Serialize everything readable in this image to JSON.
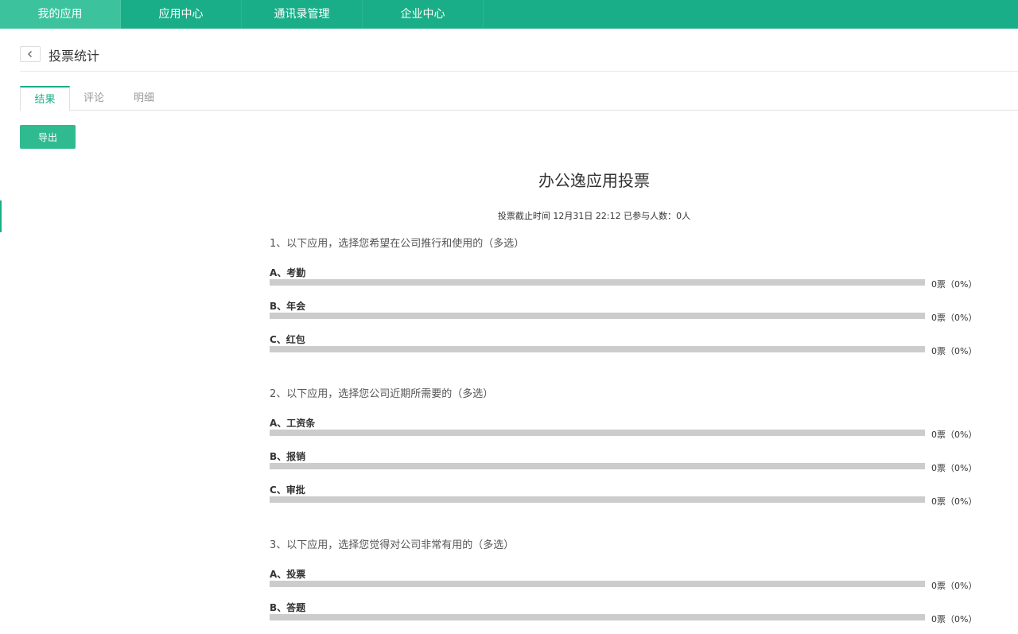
{
  "topnav": {
    "items": [
      {
        "label": "我的应用"
      },
      {
        "label": "应用中心"
      },
      {
        "label": "通讯录管理"
      },
      {
        "label": "企业中心"
      }
    ]
  },
  "header": {
    "title": "投票统计"
  },
  "tabs": [
    {
      "label": "结果"
    },
    {
      "label": "评论"
    },
    {
      "label": "明细"
    }
  ],
  "toolbar": {
    "export_label": "导出"
  },
  "vote": {
    "title": "办公逸应用投票",
    "meta": "投票截止时间 12月31日 22:12  已参与人数：0人",
    "questions": [
      {
        "title": "1、以下应用，选择您希望在公司推行和使用的（多选）",
        "options": [
          {
            "label": "A、考勤",
            "count": "0票（0%）",
            "percent": 0
          },
          {
            "label": "B、年会",
            "count": "0票（0%）",
            "percent": 0
          },
          {
            "label": "C、红包",
            "count": "0票（0%）",
            "percent": 0
          }
        ]
      },
      {
        "title": "2、以下应用，选择您公司近期所需要的（多选）",
        "options": [
          {
            "label": "A、工资条",
            "count": "0票（0%）",
            "percent": 0
          },
          {
            "label": "B、报销",
            "count": "0票（0%）",
            "percent": 0
          },
          {
            "label": "C、审批",
            "count": "0票（0%）",
            "percent": 0
          }
        ]
      },
      {
        "title": "3、以下应用，选择您觉得对公司非常有用的（多选）",
        "options": [
          {
            "label": "A、投票",
            "count": "0票（0%）",
            "percent": 0
          },
          {
            "label": "B、答题",
            "count": "0票（0%）",
            "percent": 0
          }
        ]
      }
    ]
  },
  "colors": {
    "brand": "#1aae88",
    "bar": "#cccccc"
  }
}
